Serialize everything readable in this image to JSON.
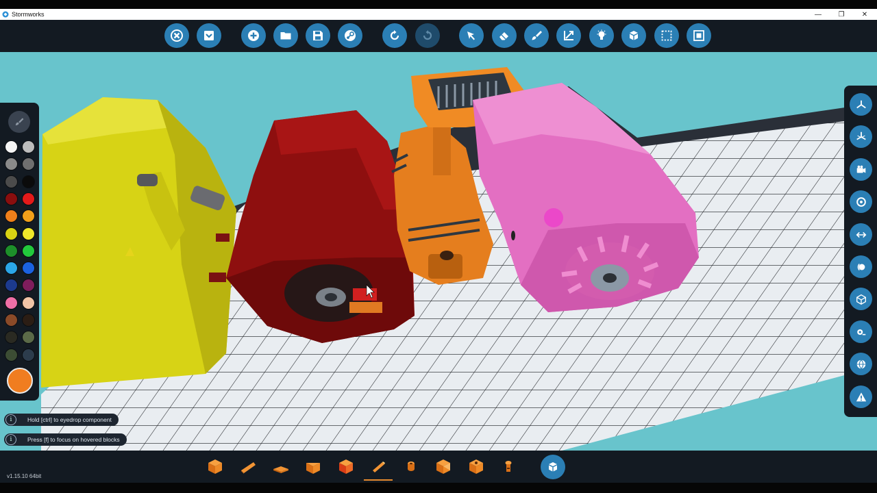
{
  "window": {
    "title": "Stormworks",
    "controls": {
      "minimize": "—",
      "restore": "❐",
      "close": "✕"
    }
  },
  "toolbar": {
    "buttons": [
      {
        "id": "close",
        "icon": "close-circle-icon"
      },
      {
        "id": "menu",
        "icon": "dropdown-icon"
      },
      {
        "id": "new",
        "icon": "plus-icon"
      },
      {
        "id": "open",
        "icon": "folder-icon"
      },
      {
        "id": "save",
        "icon": "save-icon"
      },
      {
        "id": "workshop",
        "icon": "steam-icon"
      },
      {
        "id": "undo",
        "icon": "undo-icon"
      },
      {
        "id": "redo",
        "icon": "redo-icon"
      },
      {
        "id": "select",
        "icon": "cursor-icon"
      },
      {
        "id": "erase",
        "icon": "eraser-icon"
      },
      {
        "id": "paint",
        "icon": "paint-brush-icon"
      },
      {
        "id": "transform",
        "icon": "transform-icon"
      },
      {
        "id": "logic",
        "icon": "lightbulb-icon"
      },
      {
        "id": "components",
        "icon": "cubes-icon"
      },
      {
        "id": "selection",
        "icon": "marquee-icon"
      },
      {
        "id": "merge",
        "icon": "merge-icon"
      }
    ]
  },
  "palette": {
    "header_icon": "paint-brush-icon",
    "swatches": [
      "#f5f5f5",
      "#bdbdbd",
      "#8a8a8a",
      "#6f6f6f",
      "#4b4b4b",
      "#0b0b0b",
      "#8a0e0e",
      "#e31a1a",
      "#ef7f1a",
      "#f2a01a",
      "#d9d313",
      "#f0e82a",
      "#1d8f2a",
      "#22c93c",
      "#2ba6e8",
      "#1b62e0",
      "#1c3a8f",
      "#7f1d5c",
      "#ef6fa6",
      "#f1c4a6",
      "#8a4a28",
      "#2b1d14",
      "#2a2a22",
      "#5b6a48",
      "#3c4d34",
      "#2c3c4c"
    ],
    "current_color": "#f07d20"
  },
  "right_panel": {
    "buttons": [
      "axis-top-icon",
      "axis-iso-icon",
      "camera-icon",
      "target-icon",
      "arrows-icon",
      "orbit-icon",
      "cube-icon",
      "tag-icon",
      "globe-icon",
      "warning-icon"
    ]
  },
  "hints": [
    {
      "text": "Hold [ctrl] to eyedrop component"
    },
    {
      "text": "Press [f] to focus on hovered blocks"
    }
  ],
  "status": {
    "version": "v1.15.10 64bit"
  },
  "block_bar": {
    "slots": [
      {
        "icon": "block-cube-icon"
      },
      {
        "icon": "block-wedge-icon"
      },
      {
        "icon": "block-slope-icon"
      },
      {
        "icon": "block-pyramid-icon"
      },
      {
        "icon": "block-corner-icon"
      },
      {
        "icon": "block-rod-icon"
      },
      {
        "icon": "block-pipe-icon"
      },
      {
        "icon": "block-inverted-icon"
      },
      {
        "icon": "block-half-icon"
      },
      {
        "icon": "block-connector-icon"
      }
    ],
    "active_index": 5,
    "inventory_icon": "cubes-icon"
  },
  "colors": {
    "accent": "#2b7fb5",
    "panel": "#131a22",
    "sky": "#68c4cc",
    "grid": "#e9edf1",
    "highlight": "#e68a2e"
  }
}
